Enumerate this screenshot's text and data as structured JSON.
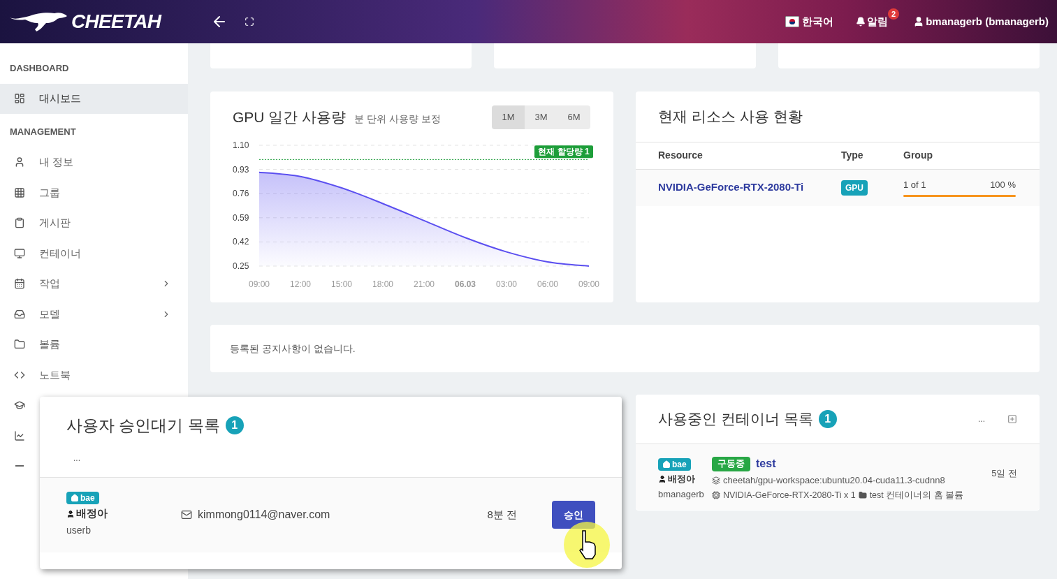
{
  "header": {
    "brand": "CHEETAH",
    "language": "한국어",
    "alerts": {
      "label": "알림",
      "count": "2"
    },
    "user": "bmanagerb (bmanagerb)"
  },
  "sidebar": {
    "sections": [
      {
        "title": "DASHBOARD",
        "items": [
          {
            "label": "대시보드",
            "selected": true,
            "has_children": false
          }
        ]
      },
      {
        "title": "MANAGEMENT",
        "items": [
          {
            "label": "내 정보",
            "selected": false,
            "has_children": false
          },
          {
            "label": "그룹",
            "selected": false,
            "has_children": false
          },
          {
            "label": "게시판",
            "selected": false,
            "has_children": false
          },
          {
            "label": "컨테이너",
            "selected": false,
            "has_children": false
          },
          {
            "label": "작업",
            "selected": false,
            "has_children": true
          },
          {
            "label": "모델",
            "selected": false,
            "has_children": true
          },
          {
            "label": "볼륨",
            "selected": false,
            "has_children": false
          },
          {
            "label": "노트북",
            "selected": false,
            "has_children": false
          },
          {
            "selected": false
          },
          {
            "selected": false
          },
          {
            "selected": false
          }
        ]
      }
    ]
  },
  "gpu_usage": {
    "title": "GPU 일간 사용량",
    "subtitle": "분 단위 사용량 보정",
    "ranges": [
      {
        "label": "1M",
        "selected": true
      },
      {
        "label": "3M",
        "selected": false
      },
      {
        "label": "6M",
        "selected": false
      }
    ],
    "chart_data": {
      "type": "area",
      "grid": true,
      "categories": [
        "09:00",
        "12:00",
        "15:00",
        "18:00",
        "21:00",
        "06.03",
        "03:00",
        "06:00",
        "09:00"
      ],
      "series": [
        {
          "color": "#5b4ff0",
          "values": [
            0.91,
            0.88,
            0.8,
            0.69,
            0.57,
            0.45,
            0.35,
            0.28,
            0.25
          ]
        },
        {
          "type": "line",
          "line_style": "dotted",
          "color": "#1e9e3a",
          "values": [
            1,
            1,
            1,
            1,
            1,
            1,
            1,
            1,
            1
          ]
        }
      ],
      "ylim": [
        0.25,
        1.1
      ],
      "yticks": [
        0.25,
        {
          "value": 0.42,
          "label": "0.42"
        },
        {
          "value": 0.59,
          "label": "0.59"
        },
        {
          "value": 0.76,
          "label": "0.76"
        },
        {
          "value": 0.93,
          "label": "0.93"
        },
        {
          "value": 1.1,
          "label": "1.10"
        }
      ]
    },
    "quota_label": "현재 할당량 1"
  },
  "resources": {
    "title": "현재 리소스 사용 현황",
    "columns": [
      "Resource",
      "Type",
      "Group"
    ],
    "rows": [
      {
        "resource": "NVIDIA-GeForce-RTX-2080-Ti",
        "type": "GPU",
        "group": "1 of 1",
        "percent": "100 %",
        "level": 1
      }
    ]
  },
  "notice": {
    "text": "등록된 공지사항이 없습니다."
  },
  "pending_users": {
    "title": "사용자 승인대기 목록",
    "count": "1",
    "more": "...",
    "rows": [
      {
        "group": "bae",
        "name": "배정아",
        "username": "userb",
        "email": "kimmong0114@naver.com",
        "time": "8분 전",
        "action": "승인"
      }
    ]
  },
  "containers": {
    "title": "사용중인 컨테이너 목록",
    "count": "1",
    "more": "...",
    "rows": [
      {
        "group": "bae",
        "name": "배정아",
        "username": "bmanagerb",
        "status": "구동중",
        "container": "test",
        "image": "cheetah/gpu-workspace:ubuntu20.04-cuda11.3-cudnn8",
        "gpu": "NVIDIA-GeForce-RTX-2080-Ti x 1",
        "volume": "test 컨테이너의 홈 볼륨",
        "time": "5일 전"
      }
    ]
  }
}
